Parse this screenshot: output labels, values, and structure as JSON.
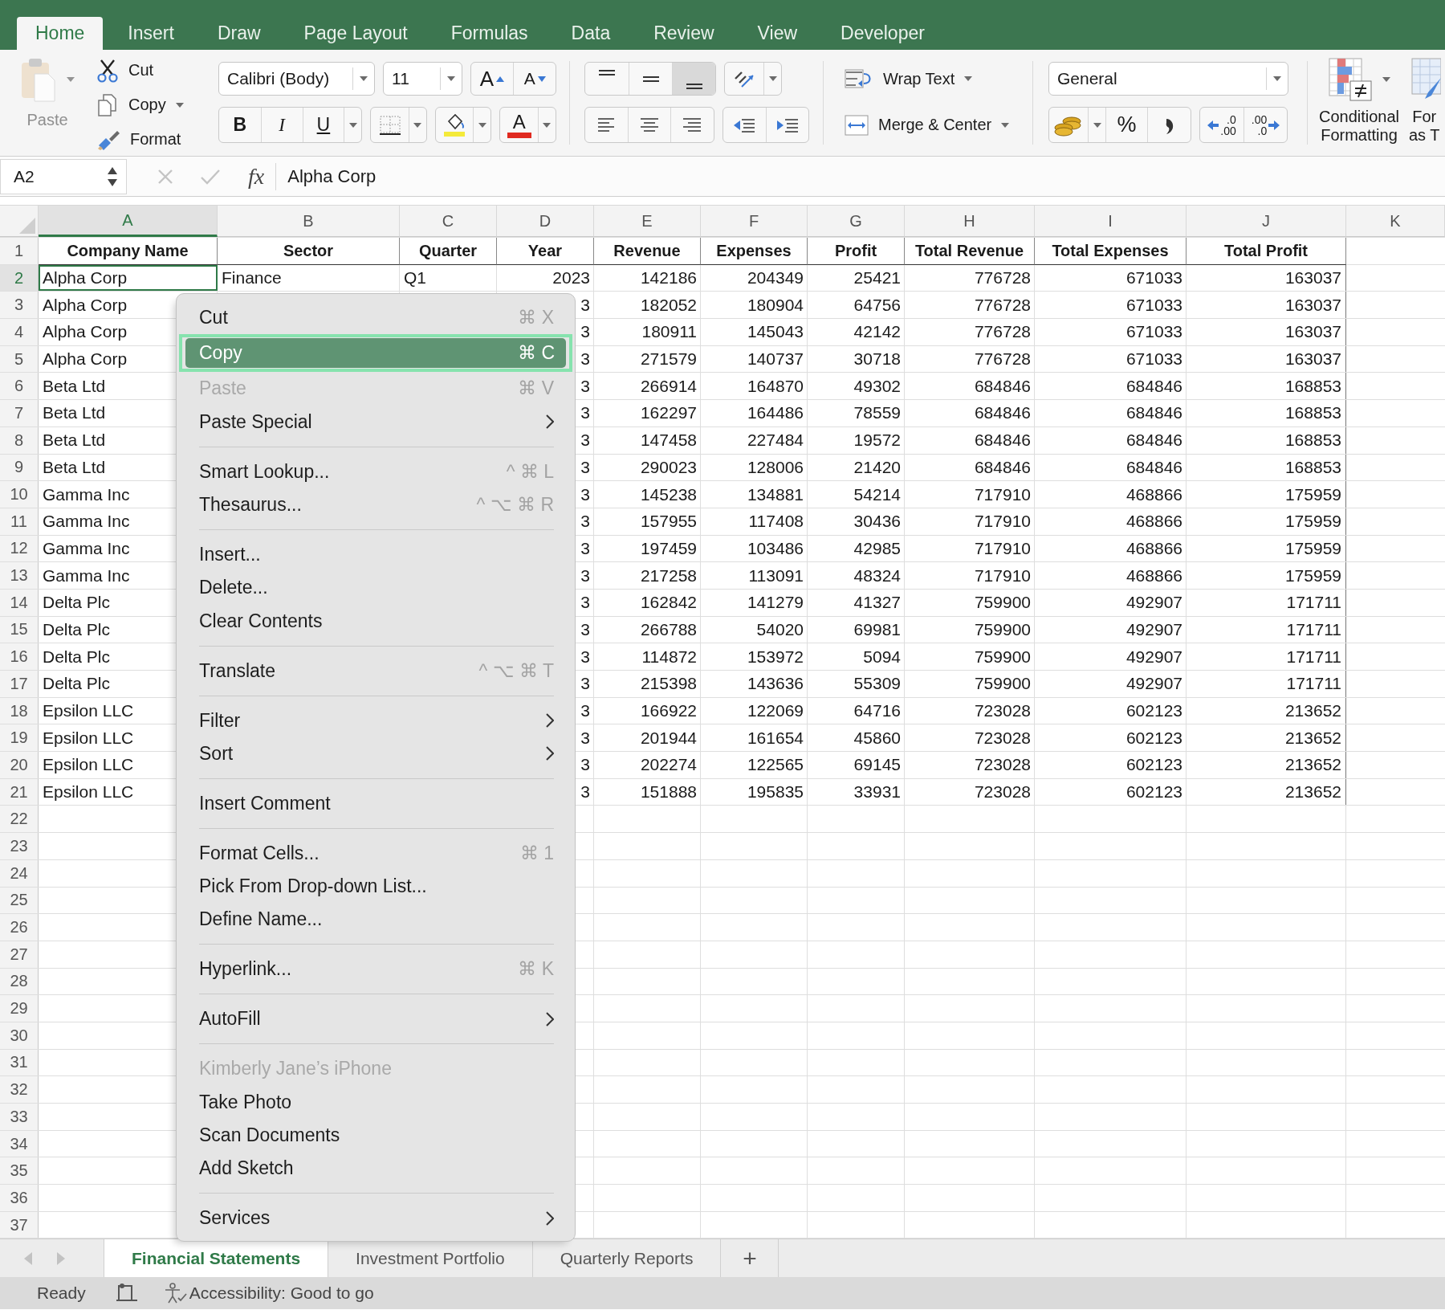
{
  "ribbon_tabs": [
    {
      "label": "Home",
      "selected": true
    },
    {
      "label": "Insert",
      "selected": false
    },
    {
      "label": "Draw",
      "selected": false
    },
    {
      "label": "Page Layout",
      "selected": false
    },
    {
      "label": "Formulas",
      "selected": false
    },
    {
      "label": "Data",
      "selected": false
    },
    {
      "label": "Review",
      "selected": false
    },
    {
      "label": "View",
      "selected": false
    },
    {
      "label": "Developer",
      "selected": false
    }
  ],
  "ribbon": {
    "clipboard": {
      "paste": {
        "label": "Paste",
        "disabled": true
      },
      "actions": [
        {
          "kind": "cut",
          "label": "Cut",
          "dropdown": false
        },
        {
          "kind": "copy",
          "label": "Copy",
          "dropdown": true
        },
        {
          "kind": "format",
          "label": "Format",
          "dropdown": false
        }
      ]
    },
    "font": {
      "name": "Calibri (Body)",
      "size": "11",
      "grow": "A",
      "shrink": "A",
      "styles": [
        {
          "kind": "bold",
          "label": "B"
        },
        {
          "kind": "italic",
          "label": "I"
        },
        {
          "kind": "underline",
          "label": "U"
        }
      ],
      "font_color": "A"
    },
    "alignment": {
      "vertical": [
        {
          "kind": "top",
          "selected": false
        },
        {
          "kind": "middle",
          "selected": false
        },
        {
          "kind": "bottom",
          "selected": true
        }
      ],
      "horizontal": [
        {
          "kind": "left",
          "selected": false
        },
        {
          "kind": "center",
          "selected": false
        },
        {
          "kind": "right",
          "selected": false
        }
      ]
    },
    "wrap_text": "Wrap Text",
    "merge": "Merge & Center",
    "number": {
      "format": "General",
      "percent": "%",
      "increase_decimal": [
        ".0",
        ".00"
      ],
      "decrease_decimal": [
        ".00",
        ".0"
      ]
    },
    "conditional_formatting": [
      "Conditional",
      "Formatting"
    ],
    "format_as_table": [
      "For",
      "as T"
    ]
  },
  "formula_bar": {
    "name_box": "A2",
    "fx": "fx",
    "formula": "Alpha Corp"
  },
  "sheet": {
    "columns": [
      {
        "label": "A",
        "selected": true
      },
      {
        "label": "B",
        "selected": false
      },
      {
        "label": "C",
        "selected": false
      },
      {
        "label": "D",
        "selected": false
      },
      {
        "label": "E",
        "selected": false
      },
      {
        "label": "F",
        "selected": false
      },
      {
        "label": "G",
        "selected": false
      },
      {
        "label": "H",
        "selected": false
      },
      {
        "label": "I",
        "selected": false
      },
      {
        "label": "J",
        "selected": false
      },
      {
        "label": "K",
        "selected": false
      }
    ],
    "header_row": {
      "number": "1",
      "selected": false,
      "cells": {
        "company": "Company Name",
        "sector": "Sector",
        "quarter": "Quarter",
        "year": "Year",
        "revenue": "Revenue",
        "expenses": "Expenses",
        "profit": "Profit",
        "total_revenue": "Total Revenue",
        "total_expenses": "Total Expenses",
        "total_profit": "Total Profit"
      }
    },
    "rows": [
      {
        "number": "2",
        "selected": true,
        "cells": {
          "company": "Alpha Corp",
          "sector": "Finance",
          "quarter": "Q1",
          "year": "2023",
          "revenue": "142186",
          "expenses": "204349",
          "profit": "25421",
          "total_revenue": "776728",
          "total_expenses": "671033",
          "total_profit": "163037"
        }
      },
      {
        "number": "3",
        "selected": false,
        "cells": {
          "company": "Alpha Corp",
          "year": "3",
          "revenue": "182052",
          "expenses": "180904",
          "profit": "64756",
          "total_revenue": "776728",
          "total_expenses": "671033",
          "total_profit": "163037"
        }
      },
      {
        "number": "4",
        "selected": false,
        "cells": {
          "company": "Alpha Corp",
          "year": "3",
          "revenue": "180911",
          "expenses": "145043",
          "profit": "42142",
          "total_revenue": "776728",
          "total_expenses": "671033",
          "total_profit": "163037"
        }
      },
      {
        "number": "5",
        "selected": false,
        "cells": {
          "company": "Alpha Corp",
          "year": "3",
          "revenue": "271579",
          "expenses": "140737",
          "profit": "30718",
          "total_revenue": "776728",
          "total_expenses": "671033",
          "total_profit": "163037"
        }
      },
      {
        "number": "6",
        "selected": false,
        "cells": {
          "company": "Beta Ltd",
          "year": "3",
          "revenue": "266914",
          "expenses": "164870",
          "profit": "49302",
          "total_revenue": "684846",
          "total_expenses": "684846",
          "total_profit": "168853"
        }
      },
      {
        "number": "7",
        "selected": false,
        "cells": {
          "company": "Beta Ltd",
          "year": "3",
          "revenue": "162297",
          "expenses": "164486",
          "profit": "78559",
          "total_revenue": "684846",
          "total_expenses": "684846",
          "total_profit": "168853"
        }
      },
      {
        "number": "8",
        "selected": false,
        "cells": {
          "company": "Beta Ltd",
          "year": "3",
          "revenue": "147458",
          "expenses": "227484",
          "profit": "19572",
          "total_revenue": "684846",
          "total_expenses": "684846",
          "total_profit": "168853"
        }
      },
      {
        "number": "9",
        "selected": false,
        "cells": {
          "company": "Beta Ltd",
          "year": "3",
          "revenue": "290023",
          "expenses": "128006",
          "profit": "21420",
          "total_revenue": "684846",
          "total_expenses": "684846",
          "total_profit": "168853"
        }
      },
      {
        "number": "10",
        "selected": false,
        "cells": {
          "company": "Gamma Inc",
          "year": "3",
          "revenue": "145238",
          "expenses": "134881",
          "profit": "54214",
          "total_revenue": "717910",
          "total_expenses": "468866",
          "total_profit": "175959"
        }
      },
      {
        "number": "11",
        "selected": false,
        "cells": {
          "company": "Gamma Inc",
          "year": "3",
          "revenue": "157955",
          "expenses": "117408",
          "profit": "30436",
          "total_revenue": "717910",
          "total_expenses": "468866",
          "total_profit": "175959"
        }
      },
      {
        "number": "12",
        "selected": false,
        "cells": {
          "company": "Gamma Inc",
          "year": "3",
          "revenue": "197459",
          "expenses": "103486",
          "profit": "42985",
          "total_revenue": "717910",
          "total_expenses": "468866",
          "total_profit": "175959"
        }
      },
      {
        "number": "13",
        "selected": false,
        "cells": {
          "company": "Gamma Inc",
          "year": "3",
          "revenue": "217258",
          "expenses": "113091",
          "profit": "48324",
          "total_revenue": "717910",
          "total_expenses": "468866",
          "total_profit": "175959"
        }
      },
      {
        "number": "14",
        "selected": false,
        "cells": {
          "company": "Delta Plc",
          "year": "3",
          "revenue": "162842",
          "expenses": "141279",
          "profit": "41327",
          "total_revenue": "759900",
          "total_expenses": "492907",
          "total_profit": "171711"
        }
      },
      {
        "number": "15",
        "selected": false,
        "cells": {
          "company": "Delta Plc",
          "year": "3",
          "revenue": "266788",
          "expenses": "54020",
          "profit": "69981",
          "total_revenue": "759900",
          "total_expenses": "492907",
          "total_profit": "171711"
        }
      },
      {
        "number": "16",
        "selected": false,
        "cells": {
          "company": "Delta Plc",
          "year": "3",
          "revenue": "114872",
          "expenses": "153972",
          "profit": "5094",
          "total_revenue": "759900",
          "total_expenses": "492907",
          "total_profit": "171711"
        }
      },
      {
        "number": "17",
        "selected": false,
        "cells": {
          "company": "Delta Plc",
          "year": "3",
          "revenue": "215398",
          "expenses": "143636",
          "profit": "55309",
          "total_revenue": "759900",
          "total_expenses": "492907",
          "total_profit": "171711"
        }
      },
      {
        "number": "18",
        "selected": false,
        "cells": {
          "company": "Epsilon LLC",
          "year": "3",
          "revenue": "166922",
          "expenses": "122069",
          "profit": "64716",
          "total_revenue": "723028",
          "total_expenses": "602123",
          "total_profit": "213652"
        }
      },
      {
        "number": "19",
        "selected": false,
        "cells": {
          "company": "Epsilon LLC",
          "year": "3",
          "revenue": "201944",
          "expenses": "161654",
          "profit": "45860",
          "total_revenue": "723028",
          "total_expenses": "602123",
          "total_profit": "213652"
        }
      },
      {
        "number": "20",
        "selected": false,
        "cells": {
          "company": "Epsilon LLC",
          "year": "3",
          "revenue": "202274",
          "expenses": "122565",
          "profit": "69145",
          "total_revenue": "723028",
          "total_expenses": "602123",
          "total_profit": "213652"
        }
      },
      {
        "number": "21",
        "selected": false,
        "cells": {
          "company": "Epsilon LLC",
          "year": "3",
          "revenue": "151888",
          "expenses": "195835",
          "profit": "33931",
          "total_revenue": "723028",
          "total_expenses": "602123",
          "total_profit": "213652"
        }
      },
      {
        "number": "22",
        "selected": false
      },
      {
        "number": "23",
        "selected": false
      },
      {
        "number": "24",
        "selected": false
      },
      {
        "number": "25",
        "selected": false
      },
      {
        "number": "26",
        "selected": false
      },
      {
        "number": "27",
        "selected": false
      },
      {
        "number": "28",
        "selected": false
      },
      {
        "number": "29",
        "selected": false
      },
      {
        "number": "30",
        "selected": false
      },
      {
        "number": "31",
        "selected": false
      },
      {
        "number": "32",
        "selected": false
      },
      {
        "number": "33",
        "selected": false
      },
      {
        "number": "34",
        "selected": false
      },
      {
        "number": "35",
        "selected": false
      },
      {
        "number": "36",
        "selected": false
      },
      {
        "number": "37",
        "selected": false
      }
    ]
  },
  "context_menu": {
    "groups": [
      [
        {
          "label": "Cut",
          "shortcut": "⌘ X",
          "submenu": false,
          "disabled": false,
          "selected": false
        },
        {
          "label": "Copy",
          "shortcut": "⌘ C",
          "submenu": false,
          "disabled": false,
          "selected": true
        },
        {
          "label": "Paste",
          "shortcut": "⌘ V",
          "submenu": false,
          "disabled": true,
          "selected": false
        },
        {
          "label": "Paste Special",
          "submenu": true,
          "disabled": false,
          "selected": false
        }
      ],
      [
        {
          "label": "Smart Lookup...",
          "shortcut": "^ ⌘ L",
          "submenu": false,
          "disabled": false,
          "selected": false
        },
        {
          "label": "Thesaurus...",
          "shortcut": "^ ⌥ ⌘ R",
          "submenu": false,
          "disabled": false,
          "selected": false
        }
      ],
      [
        {
          "label": "Insert...",
          "submenu": false,
          "disabled": false,
          "selected": false
        },
        {
          "label": "Delete...",
          "submenu": false,
          "disabled": false,
          "selected": false
        },
        {
          "label": "Clear Contents",
          "submenu": false,
          "disabled": false,
          "selected": false
        }
      ],
      [
        {
          "label": "Translate",
          "shortcut": "^ ⌥ ⌘ T",
          "submenu": false,
          "disabled": false,
          "selected": false
        }
      ],
      [
        {
          "label": "Filter",
          "submenu": true,
          "disabled": false,
          "selected": false
        },
        {
          "label": "Sort",
          "submenu": true,
          "disabled": false,
          "selected": false
        }
      ],
      [
        {
          "label": "Insert Comment",
          "submenu": false,
          "disabled": false,
          "selected": false
        }
      ],
      [
        {
          "label": "Format Cells...",
          "shortcut": "⌘ 1",
          "submenu": false,
          "disabled": false,
          "selected": false
        },
        {
          "label": "Pick From Drop-down List...",
          "submenu": false,
          "disabled": false,
          "selected": false
        },
        {
          "label": "Define Name...",
          "submenu": false,
          "disabled": false,
          "selected": false
        }
      ],
      [
        {
          "label": "Hyperlink...",
          "shortcut": "⌘ K",
          "submenu": false,
          "disabled": false,
          "selected": false
        }
      ],
      [
        {
          "label": "AutoFill",
          "submenu": true,
          "disabled": false,
          "selected": false
        }
      ],
      [
        {
          "label": "Kimberly Jane’s iPhone",
          "submenu": false,
          "disabled": true,
          "selected": false
        },
        {
          "label": "Take Photo",
          "submenu": false,
          "disabled": false,
          "selected": false
        },
        {
          "label": "Scan Documents",
          "submenu": false,
          "disabled": false,
          "selected": false
        },
        {
          "label": "Add Sketch",
          "submenu": false,
          "disabled": false,
          "selected": false
        }
      ],
      [
        {
          "label": "Services",
          "submenu": true,
          "disabled": false,
          "selected": false
        }
      ]
    ]
  },
  "sheet_tabs": [
    {
      "label": "Financial Statements",
      "selected": true
    },
    {
      "label": "Investment Portfolio",
      "selected": false
    },
    {
      "label": "Quarterly Reports",
      "selected": false
    }
  ],
  "add_sheet": "+",
  "status_bar": {
    "state": "Ready",
    "accessibility": "Accessibility: Good to go"
  }
}
